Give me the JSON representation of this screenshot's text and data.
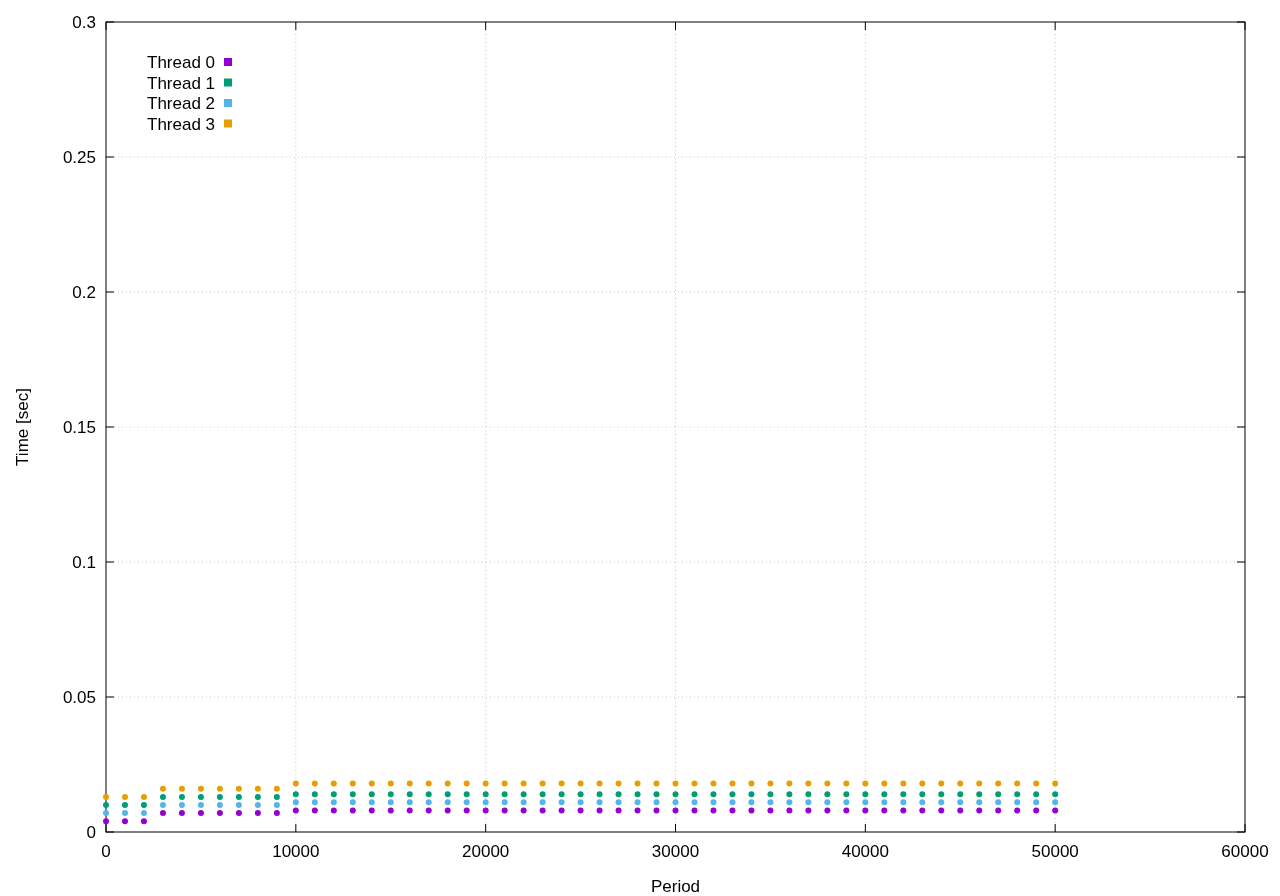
{
  "chart_data": {
    "type": "scatter",
    "grid": true,
    "legend": "top-left",
    "xlabel": "Period",
    "ylabel": "Time [sec]",
    "xlim": [
      0,
      60000
    ],
    "ylim": [
      0,
      0.3
    ],
    "xticks": [
      0,
      10000,
      20000,
      30000,
      40000,
      50000,
      60000
    ],
    "yticks": [
      0,
      {
        "value": 0.05,
        "label": "0.05"
      },
      {
        "value": 0.1,
        "label": "0.1"
      },
      {
        "value": 0.15,
        "label": "0.15"
      },
      {
        "value": 0.2,
        "label": "0.2"
      },
      {
        "value": 0.25,
        "label": "0.25"
      },
      {
        "value": 0.3,
        "label": "0.3"
      }
    ],
    "x": [
      0,
      1000,
      2000,
      3000,
      4000,
      5000,
      6000,
      7000,
      8000,
      9000,
      10000,
      11000,
      12000,
      13000,
      14000,
      15000,
      16000,
      17000,
      18000,
      19000,
      20000,
      21000,
      22000,
      23000,
      24000,
      25000,
      26000,
      27000,
      28000,
      29000,
      30000,
      31000,
      32000,
      33000,
      34000,
      35000,
      36000,
      37000,
      38000,
      39000,
      40000,
      41000,
      42000,
      43000,
      44000,
      45000,
      46000,
      47000,
      48000,
      49000,
      50000
    ],
    "series": [
      {
        "name": "Thread 0",
        "color": "#9400d3",
        "values": [
          0.004,
          0.004,
          0.004,
          0.007,
          0.007,
          0.007,
          0.007,
          0.007,
          0.007,
          0.007,
          0.008,
          0.008,
          0.008,
          0.008,
          0.008,
          0.008,
          0.008,
          0.008,
          0.008,
          0.008,
          0.008,
          0.008,
          0.008,
          0.008,
          0.008,
          0.008,
          0.008,
          0.008,
          0.008,
          0.008,
          0.008,
          0.008,
          0.008,
          0.008,
          0.008,
          0.008,
          0.008,
          0.008,
          0.008,
          0.008,
          0.008,
          0.008,
          0.008,
          0.008,
          0.008,
          0.008,
          0.008,
          0.008,
          0.008,
          0.008,
          0.008
        ]
      },
      {
        "name": "Thread 1",
        "color": "#009e73",
        "values": [
          0.01,
          0.01,
          0.01,
          0.013,
          0.013,
          0.013,
          0.013,
          0.013,
          0.013,
          0.013,
          0.014,
          0.014,
          0.014,
          0.014,
          0.014,
          0.014,
          0.014,
          0.014,
          0.014,
          0.014,
          0.014,
          0.014,
          0.014,
          0.014,
          0.014,
          0.014,
          0.014,
          0.014,
          0.014,
          0.014,
          0.014,
          0.014,
          0.014,
          0.014,
          0.014,
          0.014,
          0.014,
          0.014,
          0.014,
          0.014,
          0.014,
          0.014,
          0.014,
          0.014,
          0.014,
          0.014,
          0.014,
          0.014,
          0.014,
          0.014,
          0.014
        ]
      },
      {
        "name": "Thread 2",
        "color": "#56b4e9",
        "values": [
          0.007,
          0.007,
          0.007,
          0.01,
          0.01,
          0.01,
          0.01,
          0.01,
          0.01,
          0.01,
          0.011,
          0.011,
          0.011,
          0.011,
          0.011,
          0.011,
          0.011,
          0.011,
          0.011,
          0.011,
          0.011,
          0.011,
          0.011,
          0.011,
          0.011,
          0.011,
          0.011,
          0.011,
          0.011,
          0.011,
          0.011,
          0.011,
          0.011,
          0.011,
          0.011,
          0.011,
          0.011,
          0.011,
          0.011,
          0.011,
          0.011,
          0.011,
          0.011,
          0.011,
          0.011,
          0.011,
          0.011,
          0.011,
          0.011,
          0.011,
          0.011
        ]
      },
      {
        "name": "Thread 3",
        "color": "#e69f00",
        "values": [
          0.013,
          0.013,
          0.013,
          0.016,
          0.016,
          0.016,
          0.016,
          0.016,
          0.016,
          0.016,
          0.018,
          0.018,
          0.018,
          0.018,
          0.018,
          0.018,
          0.018,
          0.018,
          0.018,
          0.018,
          0.018,
          0.018,
          0.018,
          0.018,
          0.018,
          0.018,
          0.018,
          0.018,
          0.018,
          0.018,
          0.018,
          0.018,
          0.018,
          0.018,
          0.018,
          0.018,
          0.018,
          0.018,
          0.018,
          0.018,
          0.018,
          0.018,
          0.018,
          0.018,
          0.018,
          0.018,
          0.018,
          0.018,
          0.018,
          0.018,
          0.018
        ]
      }
    ]
  }
}
